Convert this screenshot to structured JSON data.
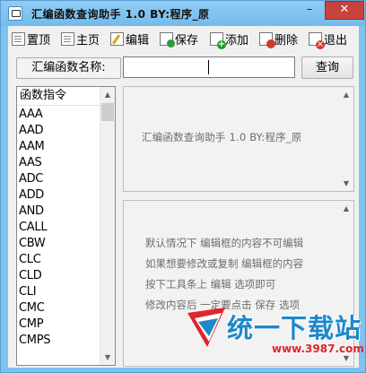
{
  "window": {
    "title": "汇编函数查询助手  1.0   BY:程序_原",
    "minimize_symbol": "–",
    "maximize_symbol": "□",
    "close_symbol": "✕"
  },
  "toolbar": {
    "items": [
      {
        "label": "置顶",
        "icon": "pin-doc-icon"
      },
      {
        "label": "主页",
        "icon": "home-doc-icon"
      },
      {
        "label": "编辑",
        "icon": "pencil-icon"
      },
      {
        "label": "保存",
        "icon": "save-icon"
      },
      {
        "label": "添加",
        "icon": "add-icon"
      },
      {
        "label": "删除",
        "icon": "delete-icon"
      },
      {
        "label": "退出",
        "icon": "exit-icon"
      }
    ]
  },
  "search": {
    "label": "汇编函数名称:",
    "value": "",
    "button": "查询"
  },
  "list": {
    "header": "函数指令",
    "items": [
      "AAA",
      "AAD",
      "AAM",
      "AAS",
      "ADC",
      "ADD",
      "AND",
      "CALL",
      "CBW",
      "CLC",
      "CLD",
      "CLI",
      "CMC",
      "CMP",
      "CMPS"
    ]
  },
  "info_panel": {
    "text": "汇编函数查询助手  1.0   BY:程序_原"
  },
  "tips_panel": {
    "lines": [
      "默认情况下 编辑框的内容不可编辑",
      "如果想要修改或复制 编辑框的内容",
      "按下工具条上 编辑 选项即可",
      "修改内容后  一定要点击 保存 选项"
    ]
  },
  "watermark": {
    "brand": "统一下载站",
    "url": "www.3987.com"
  },
  "colors": {
    "titlebar": "#7ec3f0",
    "close_button": "#c7433b",
    "watermark_blue": "#1e88c8",
    "watermark_red": "#e0262c"
  }
}
